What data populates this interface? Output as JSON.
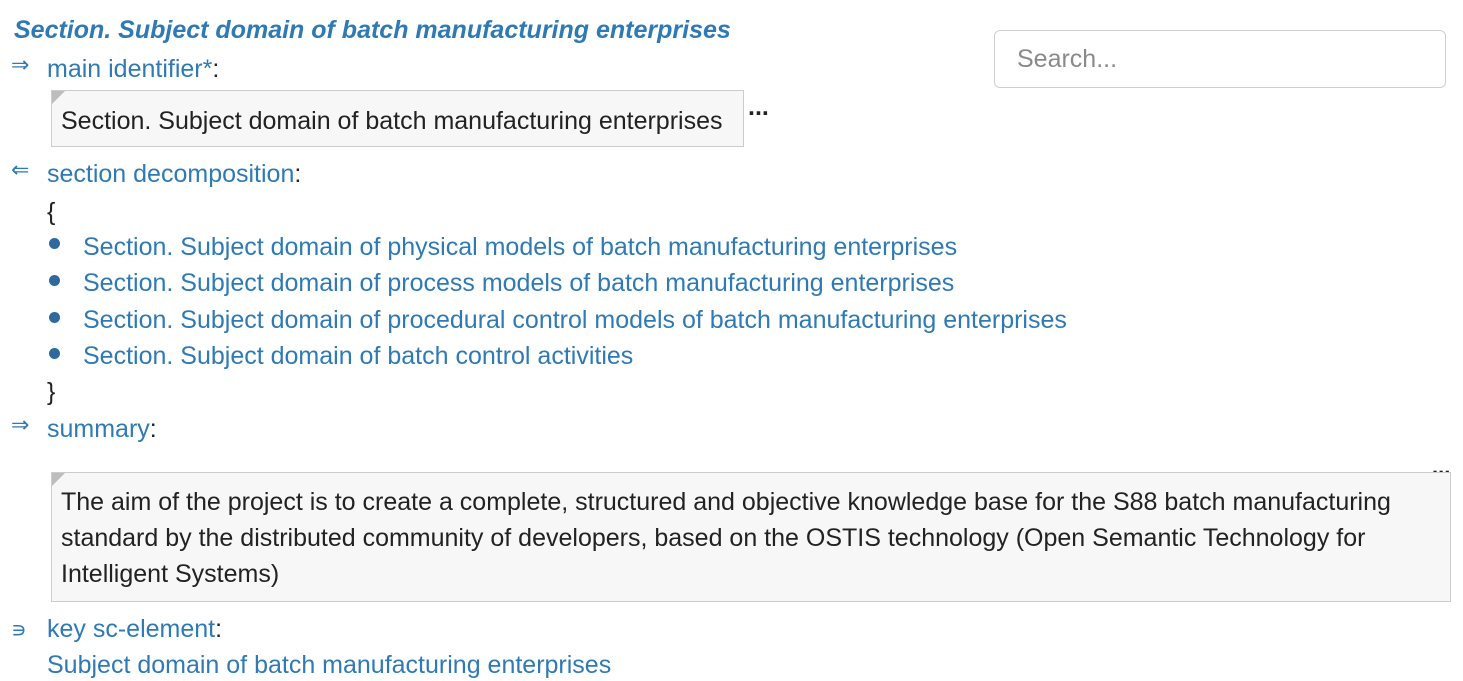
{
  "title": "Section. Subject domain of batch manufacturing enterprises",
  "search": {
    "placeholder": "Search..."
  },
  "main_identifier": {
    "arrow": "⇒",
    "label": "main identifier*",
    "colon": ":",
    "value": "Section. Subject domain of batch manufacturing enterprises",
    "more": "..."
  },
  "section_decomposition": {
    "arrow": "⇐",
    "label": "section decomposition",
    "colon": ":",
    "open_brace": "{",
    "close_brace": "}",
    "items": [
      "Section. Subject domain of physical models of batch manufacturing enterprises",
      "Section. Subject domain of process models of batch manufacturing enterprises",
      "Section. Subject domain of procedural control models of batch manufacturing enterprises",
      "Section. Subject domain of batch control activities"
    ]
  },
  "summary": {
    "arrow": "⇒",
    "label": "summary",
    "colon": ":",
    "text": "The aim of the project is to create a complete, structured and objective knowledge base for the S88 batch manufacturing standard by the distributed community of developers, based on the OSTIS technology (Open Semantic Technology for Intelligent Systems)",
    "more": "..."
  },
  "key_sc_element": {
    "arrow": "∍",
    "label": "key sc-element",
    "colon": ":",
    "value": "Subject domain of batch manufacturing enterprises"
  },
  "colors": {
    "link": "#2f7ab5",
    "bullet": "#2f6a9e",
    "box_bg": "#f7f7f7",
    "box_border": "#cccccc"
  }
}
